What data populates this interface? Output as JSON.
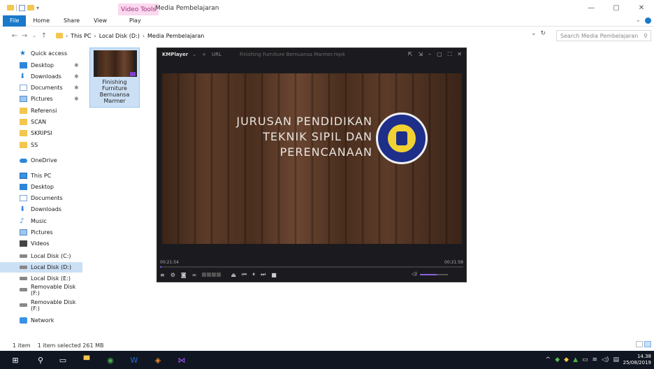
{
  "window": {
    "context_tab": "Video Tools",
    "title": "Media Pembelajaran",
    "minimize": "—",
    "maximize": "▢",
    "close": "✕"
  },
  "ribbon": {
    "tabs": [
      "File",
      "Home",
      "Share",
      "View"
    ],
    "play_tab": "Play",
    "collapse": "⌄"
  },
  "address": {
    "crumbs": [
      "This PC",
      "Local Disk (D:)",
      "Media Pembelajaran"
    ],
    "search_placeholder": "Search Media Pembelajaran"
  },
  "sidebar": {
    "items": [
      {
        "label": "Quick access",
        "icon": "star-icon"
      },
      {
        "label": "Desktop",
        "icon": "desktop-icon",
        "pinned": true
      },
      {
        "label": "Downloads",
        "icon": "download-icon",
        "pinned": true
      },
      {
        "label": "Documents",
        "icon": "documents-icon",
        "pinned": true
      },
      {
        "label": "Pictures",
        "icon": "pictures-icon",
        "pinned": true
      },
      {
        "label": "Referensi",
        "icon": "folder-icon"
      },
      {
        "label": "SCAN",
        "icon": "folder-icon"
      },
      {
        "label": "SKRIPSI",
        "icon": "folder-icon"
      },
      {
        "label": "SS",
        "icon": "folder-icon"
      },
      {
        "label": "OneDrive",
        "icon": "cloud-icon"
      },
      {
        "label": "This PC",
        "icon": "computer-icon"
      },
      {
        "label": "Desktop",
        "icon": "desktop-icon"
      },
      {
        "label": "Documents",
        "icon": "documents-icon"
      },
      {
        "label": "Downloads",
        "icon": "download-icon"
      },
      {
        "label": "Music",
        "icon": "music-icon"
      },
      {
        "label": "Pictures",
        "icon": "pictures-icon"
      },
      {
        "label": "Videos",
        "icon": "video-icon"
      },
      {
        "label": "Local Disk (C:)",
        "icon": "drive-icon"
      },
      {
        "label": "Local Disk (D:)",
        "icon": "drive-icon",
        "selected": true
      },
      {
        "label": "Local Disk (E:)",
        "icon": "drive-icon"
      },
      {
        "label": "Removable Disk (F:)",
        "icon": "usb-drive-icon"
      },
      {
        "label": "Removable Disk (F:)",
        "icon": "usb-drive-icon"
      },
      {
        "label": "Network",
        "icon": "network-icon"
      }
    ]
  },
  "file": {
    "name": "Finishing\nFurniture\nBernuansa\nMarmer"
  },
  "player": {
    "brand": "KMPlayer",
    "menu": "⌄",
    "url_label": "URL",
    "filename": "Finishing Furniture Bernuansa Marmer.mp4",
    "title_lines": [
      "JURUSAN PENDIDIKAN",
      "TEKNIK SIPIL DAN",
      "PERENCANAAN"
    ],
    "time_elapsed": "00:21:54",
    "time_total": "00:21:58",
    "progress": 0.004,
    "volume": 0.6
  },
  "status": {
    "count": "1 item",
    "selection": "1 item selected  261 MB"
  },
  "taskbar": {
    "time": "14.38",
    "date": "25/08/2019"
  }
}
